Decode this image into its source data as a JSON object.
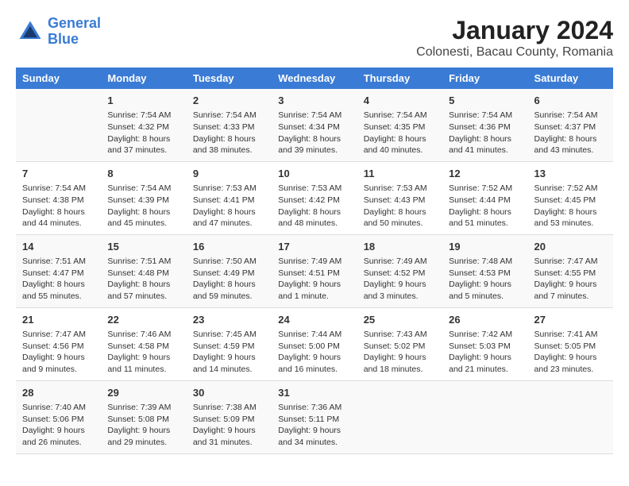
{
  "header": {
    "logo_line1": "General",
    "logo_line2": "Blue",
    "month_title": "January 2024",
    "location": "Colonesti, Bacau County, Romania"
  },
  "weekdays": [
    "Sunday",
    "Monday",
    "Tuesday",
    "Wednesday",
    "Thursday",
    "Friday",
    "Saturday"
  ],
  "weeks": [
    [
      {
        "day": "",
        "sunrise": "",
        "sunset": "",
        "daylight": ""
      },
      {
        "day": "1",
        "sunrise": "Sunrise: 7:54 AM",
        "sunset": "Sunset: 4:32 PM",
        "daylight": "Daylight: 8 hours and 37 minutes."
      },
      {
        "day": "2",
        "sunrise": "Sunrise: 7:54 AM",
        "sunset": "Sunset: 4:33 PM",
        "daylight": "Daylight: 8 hours and 38 minutes."
      },
      {
        "day": "3",
        "sunrise": "Sunrise: 7:54 AM",
        "sunset": "Sunset: 4:34 PM",
        "daylight": "Daylight: 8 hours and 39 minutes."
      },
      {
        "day": "4",
        "sunrise": "Sunrise: 7:54 AM",
        "sunset": "Sunset: 4:35 PM",
        "daylight": "Daylight: 8 hours and 40 minutes."
      },
      {
        "day": "5",
        "sunrise": "Sunrise: 7:54 AM",
        "sunset": "Sunset: 4:36 PM",
        "daylight": "Daylight: 8 hours and 41 minutes."
      },
      {
        "day": "6",
        "sunrise": "Sunrise: 7:54 AM",
        "sunset": "Sunset: 4:37 PM",
        "daylight": "Daylight: 8 hours and 43 minutes."
      }
    ],
    [
      {
        "day": "7",
        "sunrise": "Sunrise: 7:54 AM",
        "sunset": "Sunset: 4:38 PM",
        "daylight": "Daylight: 8 hours and 44 minutes."
      },
      {
        "day": "8",
        "sunrise": "Sunrise: 7:54 AM",
        "sunset": "Sunset: 4:39 PM",
        "daylight": "Daylight: 8 hours and 45 minutes."
      },
      {
        "day": "9",
        "sunrise": "Sunrise: 7:53 AM",
        "sunset": "Sunset: 4:41 PM",
        "daylight": "Daylight: 8 hours and 47 minutes."
      },
      {
        "day": "10",
        "sunrise": "Sunrise: 7:53 AM",
        "sunset": "Sunset: 4:42 PM",
        "daylight": "Daylight: 8 hours and 48 minutes."
      },
      {
        "day": "11",
        "sunrise": "Sunrise: 7:53 AM",
        "sunset": "Sunset: 4:43 PM",
        "daylight": "Daylight: 8 hours and 50 minutes."
      },
      {
        "day": "12",
        "sunrise": "Sunrise: 7:52 AM",
        "sunset": "Sunset: 4:44 PM",
        "daylight": "Daylight: 8 hours and 51 minutes."
      },
      {
        "day": "13",
        "sunrise": "Sunrise: 7:52 AM",
        "sunset": "Sunset: 4:45 PM",
        "daylight": "Daylight: 8 hours and 53 minutes."
      }
    ],
    [
      {
        "day": "14",
        "sunrise": "Sunrise: 7:51 AM",
        "sunset": "Sunset: 4:47 PM",
        "daylight": "Daylight: 8 hours and 55 minutes."
      },
      {
        "day": "15",
        "sunrise": "Sunrise: 7:51 AM",
        "sunset": "Sunset: 4:48 PM",
        "daylight": "Daylight: 8 hours and 57 minutes."
      },
      {
        "day": "16",
        "sunrise": "Sunrise: 7:50 AM",
        "sunset": "Sunset: 4:49 PM",
        "daylight": "Daylight: 8 hours and 59 minutes."
      },
      {
        "day": "17",
        "sunrise": "Sunrise: 7:49 AM",
        "sunset": "Sunset: 4:51 PM",
        "daylight": "Daylight: 9 hours and 1 minute."
      },
      {
        "day": "18",
        "sunrise": "Sunrise: 7:49 AM",
        "sunset": "Sunset: 4:52 PM",
        "daylight": "Daylight: 9 hours and 3 minutes."
      },
      {
        "day": "19",
        "sunrise": "Sunrise: 7:48 AM",
        "sunset": "Sunset: 4:53 PM",
        "daylight": "Daylight: 9 hours and 5 minutes."
      },
      {
        "day": "20",
        "sunrise": "Sunrise: 7:47 AM",
        "sunset": "Sunset: 4:55 PM",
        "daylight": "Daylight: 9 hours and 7 minutes."
      }
    ],
    [
      {
        "day": "21",
        "sunrise": "Sunrise: 7:47 AM",
        "sunset": "Sunset: 4:56 PM",
        "daylight": "Daylight: 9 hours and 9 minutes."
      },
      {
        "day": "22",
        "sunrise": "Sunrise: 7:46 AM",
        "sunset": "Sunset: 4:58 PM",
        "daylight": "Daylight: 9 hours and 11 minutes."
      },
      {
        "day": "23",
        "sunrise": "Sunrise: 7:45 AM",
        "sunset": "Sunset: 4:59 PM",
        "daylight": "Daylight: 9 hours and 14 minutes."
      },
      {
        "day": "24",
        "sunrise": "Sunrise: 7:44 AM",
        "sunset": "Sunset: 5:00 PM",
        "daylight": "Daylight: 9 hours and 16 minutes."
      },
      {
        "day": "25",
        "sunrise": "Sunrise: 7:43 AM",
        "sunset": "Sunset: 5:02 PM",
        "daylight": "Daylight: 9 hours and 18 minutes."
      },
      {
        "day": "26",
        "sunrise": "Sunrise: 7:42 AM",
        "sunset": "Sunset: 5:03 PM",
        "daylight": "Daylight: 9 hours and 21 minutes."
      },
      {
        "day": "27",
        "sunrise": "Sunrise: 7:41 AM",
        "sunset": "Sunset: 5:05 PM",
        "daylight": "Daylight: 9 hours and 23 minutes."
      }
    ],
    [
      {
        "day": "28",
        "sunrise": "Sunrise: 7:40 AM",
        "sunset": "Sunset: 5:06 PM",
        "daylight": "Daylight: 9 hours and 26 minutes."
      },
      {
        "day": "29",
        "sunrise": "Sunrise: 7:39 AM",
        "sunset": "Sunset: 5:08 PM",
        "daylight": "Daylight: 9 hours and 29 minutes."
      },
      {
        "day": "30",
        "sunrise": "Sunrise: 7:38 AM",
        "sunset": "Sunset: 5:09 PM",
        "daylight": "Daylight: 9 hours and 31 minutes."
      },
      {
        "day": "31",
        "sunrise": "Sunrise: 7:36 AM",
        "sunset": "Sunset: 5:11 PM",
        "daylight": "Daylight: 9 hours and 34 minutes."
      },
      {
        "day": "",
        "sunrise": "",
        "sunset": "",
        "daylight": ""
      },
      {
        "day": "",
        "sunrise": "",
        "sunset": "",
        "daylight": ""
      },
      {
        "day": "",
        "sunrise": "",
        "sunset": "",
        "daylight": ""
      }
    ]
  ]
}
